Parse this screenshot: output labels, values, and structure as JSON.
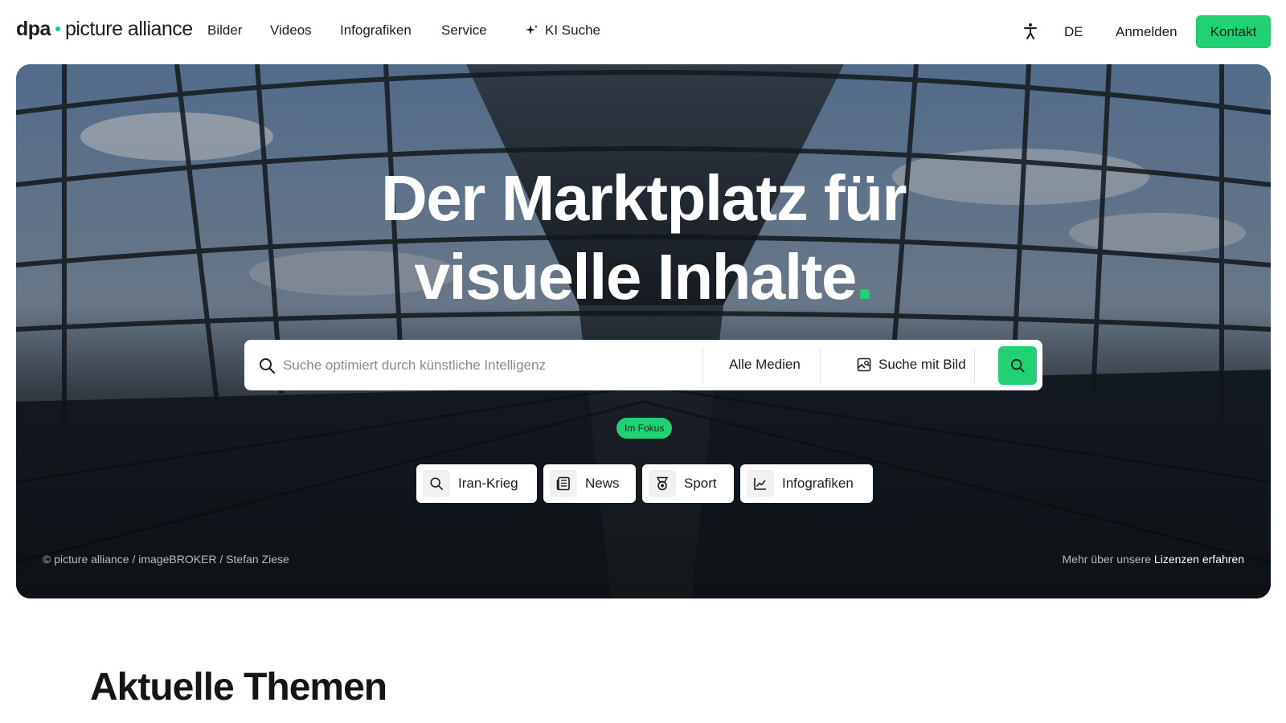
{
  "header": {
    "logo_dpa": "dpa",
    "logo_pa": "picture alliance",
    "nav": [
      "Bilder",
      "Videos",
      "Infografiken",
      "Service",
      "KI Suche"
    ],
    "lang": "DE",
    "login": "Anmelden",
    "contact": "Kontakt"
  },
  "hero": {
    "title_line1": "Der Marktplatz für",
    "title_line2": "visuelle Inhalte",
    "title_dot": ".",
    "search": {
      "placeholder": "Suche optimiert durch künstliche Intelligenz",
      "value": "",
      "media_filter": "Alle Medien",
      "image_search": "Suche mit Bild"
    },
    "focus_badge": "Im Fokus",
    "chips": [
      {
        "label": "Iran-Krieg",
        "icon": "search-icon"
      },
      {
        "label": "News",
        "icon": "newspaper-icon"
      },
      {
        "label": "Sport",
        "icon": "medal-icon"
      },
      {
        "label": "Infografiken",
        "icon": "chart-icon"
      }
    ],
    "credit": "© picture alliance / imageBROKER / Stefan Ziese",
    "license_prefix": "Mehr über unsere",
    "license_link": "Lizenzen erfahren"
  },
  "main": {
    "section_title": "Aktuelle Themen"
  },
  "colors": {
    "accent": "#22d173",
    "text": "#1d1d1d"
  }
}
